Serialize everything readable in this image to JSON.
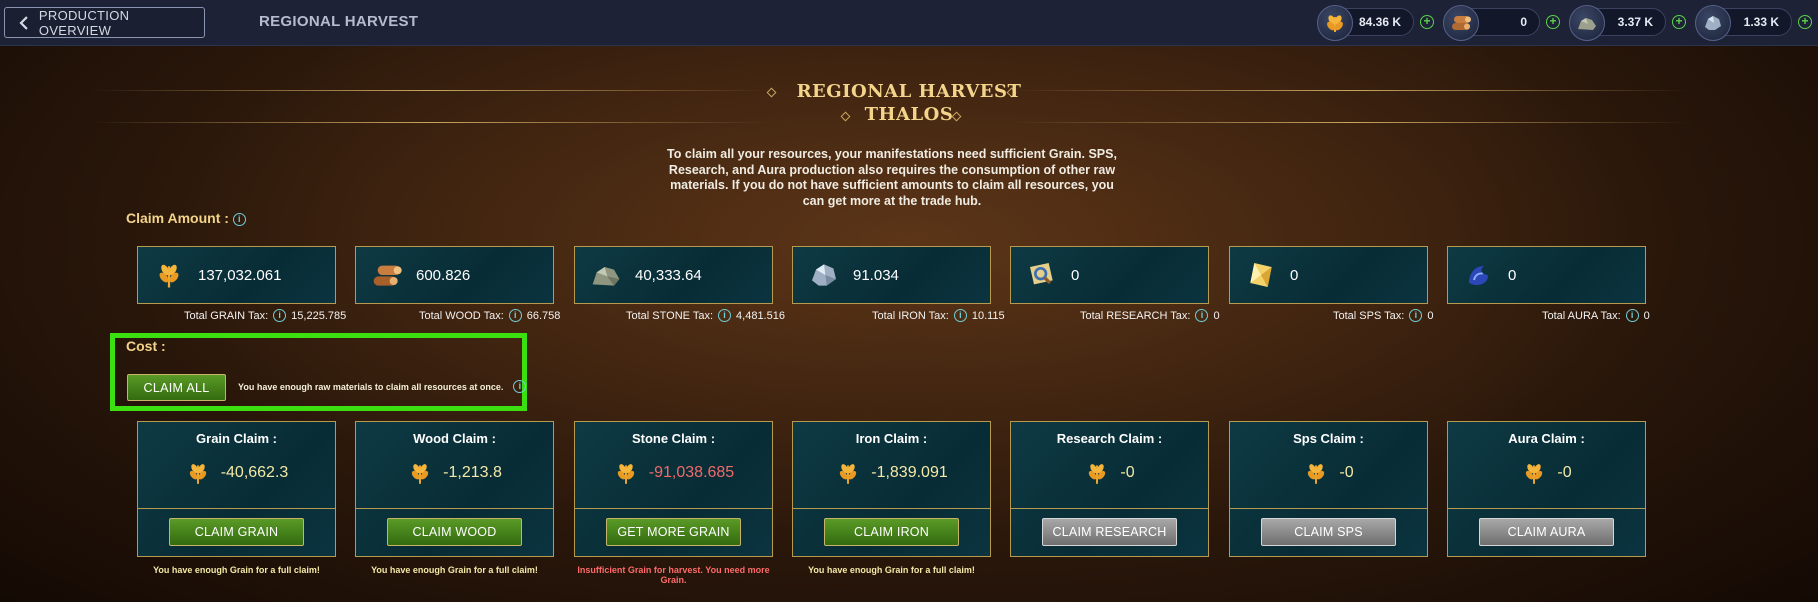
{
  "topbar": {
    "back_label": "PRODUCTION OVERVIEW",
    "page_title": "REGIONAL HARVEST",
    "resources": [
      {
        "icon": "grain-icon",
        "value": "84.36 K"
      },
      {
        "icon": "wood-icon",
        "value": "0"
      },
      {
        "icon": "stone-icon",
        "value": "3.37 K"
      },
      {
        "icon": "iron-icon",
        "value": "1.33 K"
      }
    ],
    "plus_symbol": "+"
  },
  "header": {
    "title_line1": "REGIONAL HARVEST",
    "title_line2": "THALOS",
    "description": "To claim all your resources, your manifestations need sufficient Grain. SPS, Research, and Aura production also requires the consumption of other raw materials. If you do not have sufficient amounts to claim all resources, you can get more at the trade hub."
  },
  "claim_amount": {
    "label": "Claim Amount :",
    "info_symbol": "i",
    "items": [
      {
        "icon": "grain-icon",
        "value": "137,032.061",
        "tax_label": "Total GRAIN Tax:",
        "tax_value": "15,225.785"
      },
      {
        "icon": "wood-icon",
        "value": "600.826",
        "tax_label": "Total WOOD Tax:",
        "tax_value": "66.758"
      },
      {
        "icon": "stone-icon",
        "value": "40,333.64",
        "tax_label": "Total STONE Tax:",
        "tax_value": "4,481.516"
      },
      {
        "icon": "iron-icon",
        "value": "91.034",
        "tax_label": "Total IRON Tax:",
        "tax_value": "10.115"
      },
      {
        "icon": "research-icon",
        "value": "0",
        "tax_label": "Total RESEARCH Tax:",
        "tax_value": "0"
      },
      {
        "icon": "sps-icon",
        "value": "0",
        "tax_label": "Total SPS Tax:",
        "tax_value": "0"
      },
      {
        "icon": "aura-icon",
        "value": "0",
        "tax_label": "Total AURA Tax:",
        "tax_value": "0"
      }
    ]
  },
  "cost": {
    "label": "Cost :",
    "claim_all_label": "CLAIM ALL",
    "message": "You have enough raw materials to claim all resources at once."
  },
  "claims": [
    {
      "title": "Grain Claim :",
      "value": "-40,662.3",
      "button": "CLAIM GRAIN",
      "button_style": "green",
      "value_color": "#f4e9a6",
      "message": "You have enough Grain for a full claim!",
      "message_color": "#f4e9a6"
    },
    {
      "title": "Wood Claim :",
      "value": "-1,213.8",
      "button": "CLAIM WOOD",
      "button_style": "green",
      "value_color": "#f4e9a6",
      "message": "You have enough Grain for a full claim!",
      "message_color": "#f4e9a6"
    },
    {
      "title": "Stone Claim :",
      "value": "-91,038.685",
      "button": "GET MORE GRAIN",
      "button_style": "green",
      "value_color": "#f06a6a",
      "message": "Insufficient Grain for harvest. You need more Grain.",
      "message_color": "#ff6a6a"
    },
    {
      "title": "Iron Claim :",
      "value": "-1,839.091",
      "button": "CLAIM IRON",
      "button_style": "green",
      "value_color": "#f4e9a6",
      "message": "You have enough Grain for a full claim!",
      "message_color": "#f4e9a6"
    },
    {
      "title": "Research Claim :",
      "value": "-0",
      "button": "CLAIM RESEARCH",
      "button_style": "grey",
      "value_color": "#f4e9a6",
      "message": "",
      "message_color": "#f4e9a6"
    },
    {
      "title": "Sps Claim :",
      "value": "-0",
      "button": "CLAIM SPS",
      "button_style": "grey",
      "value_color": "#f4e9a6",
      "message": "",
      "message_color": "#f4e9a6"
    },
    {
      "title": "Aura Claim :",
      "value": "-0",
      "button": "CLAIM AURA",
      "button_style": "grey",
      "value_color": "#f4e9a6",
      "message": "",
      "message_color": "#f4e9a6"
    }
  ]
}
